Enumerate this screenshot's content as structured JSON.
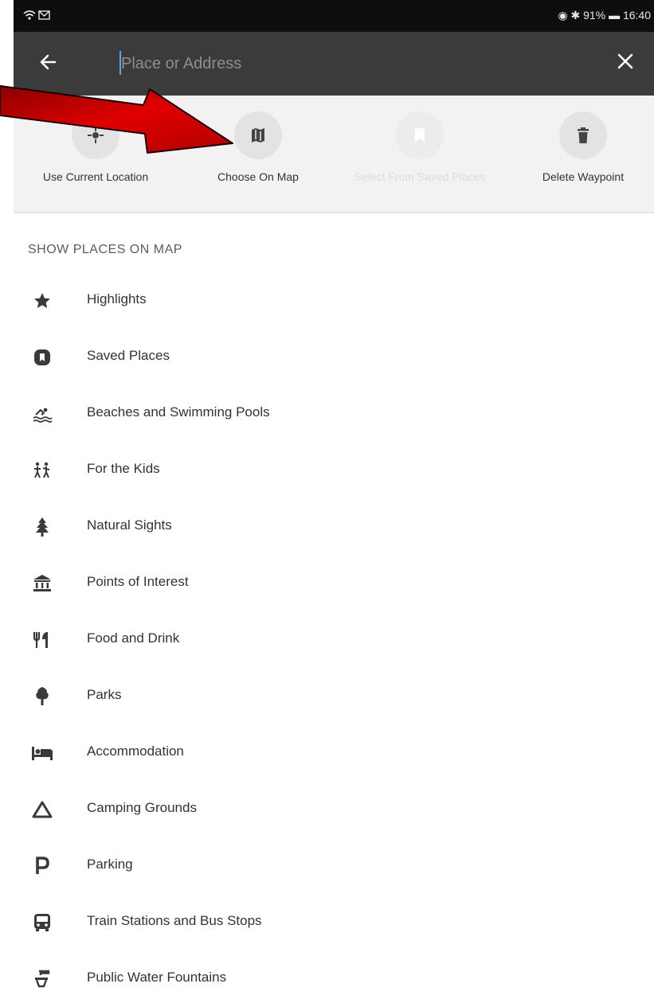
{
  "status_bar": {
    "left_icons": "wifi-icon mail-icon",
    "right_text": "91% 16:40",
    "battery": "91%",
    "time": "16:40"
  },
  "search": {
    "placeholder": "Place or Address",
    "value": ""
  },
  "actions": [
    {
      "label": "Use Current Location",
      "icon": "location-icon",
      "enabled": true
    },
    {
      "label": "Choose On Map",
      "icon": "map-icon",
      "enabled": true
    },
    {
      "label": "Select From Saved Places",
      "icon": "bookmark-icon",
      "enabled": false
    },
    {
      "label": "Delete Waypoint",
      "icon": "trash-icon",
      "enabled": true
    }
  ],
  "section": {
    "title": "SHOW PLACES ON MAP"
  },
  "places": [
    {
      "label": "Highlights",
      "icon": "star-icon"
    },
    {
      "label": "Saved Places",
      "icon": "saved-places-icon"
    },
    {
      "label": "Beaches and Swimming Pools",
      "icon": "swimmer-icon"
    },
    {
      "label": "For the Kids",
      "icon": "kids-icon"
    },
    {
      "label": "Natural Sights",
      "icon": "tree-icon"
    },
    {
      "label": "Points of Interest",
      "icon": "museum-icon"
    },
    {
      "label": "Food and Drink",
      "icon": "cutlery-icon"
    },
    {
      "label": "Parks",
      "icon": "park-tree-icon"
    },
    {
      "label": "Accommodation",
      "icon": "bed-icon"
    },
    {
      "label": "Camping Grounds",
      "icon": "tent-icon"
    },
    {
      "label": "Parking",
      "icon": "parking-icon"
    },
    {
      "label": "Train Stations and Bus Stops",
      "icon": "bus-icon"
    },
    {
      "label": "Public Water Fountains",
      "icon": "fountain-icon"
    }
  ],
  "colors": {
    "app_bar": "#3b3b3b",
    "status_bar": "#0e0e0e",
    "actions_bg": "#f2f2f2",
    "annotation_arrow": "#d40000"
  }
}
